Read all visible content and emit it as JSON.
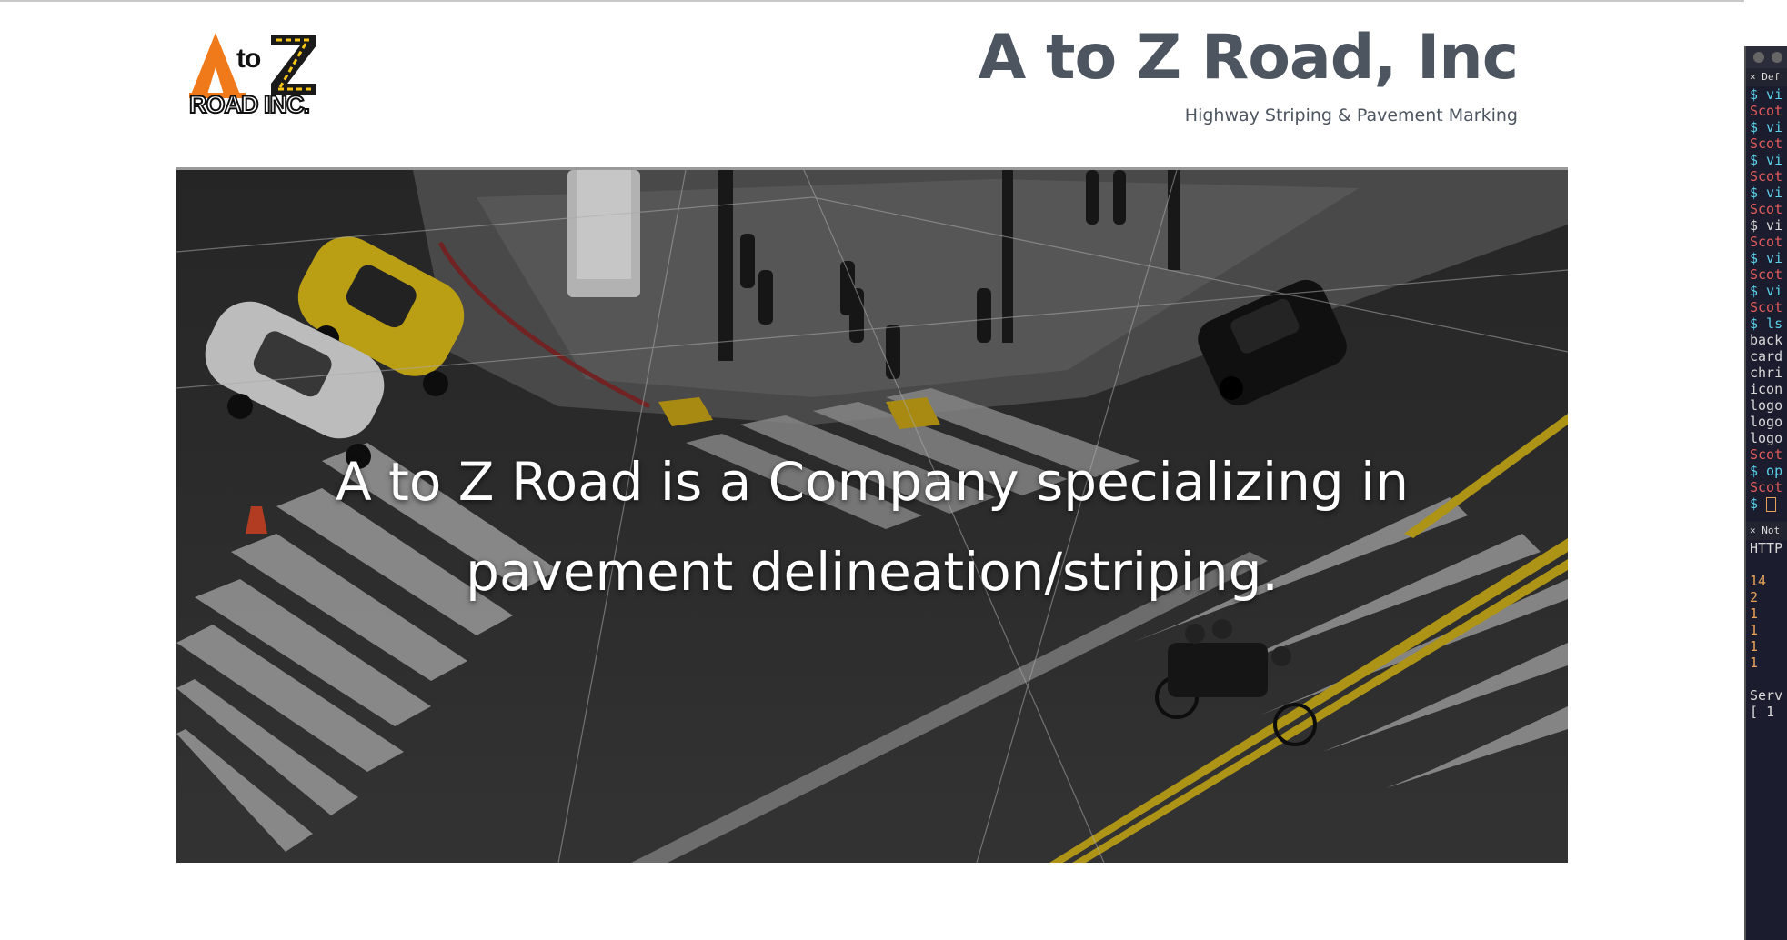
{
  "header": {
    "logo_text_line1_a": "A",
    "logo_text_line1_to": "to",
    "logo_text_line1_z": "Z",
    "logo_text_line2": "ROAD INC.",
    "title": "A to Z Road, Inc",
    "subtitle": "Highway Striping & Pavement Marking"
  },
  "hero": {
    "line1": "A to Z Road is a Company specializing in",
    "line2": "pavement delineation/striping."
  },
  "terminal": {
    "tab1": "Def",
    "tab2": "Not",
    "lines": [
      {
        "cls": "c-prompt",
        "text": "$ vi"
      },
      {
        "cls": "c-red",
        "text": "Scot"
      },
      {
        "cls": "c-prompt",
        "text": "$ vi"
      },
      {
        "cls": "c-red",
        "text": "Scot"
      },
      {
        "cls": "c-prompt",
        "text": "$ vi"
      },
      {
        "cls": "c-red",
        "text": "Scot"
      },
      {
        "cls": "c-prompt",
        "text": "$ vi"
      },
      {
        "cls": "c-red",
        "text": "Scot"
      },
      {
        "cls": "c-white",
        "text": "$ vi"
      },
      {
        "cls": "c-red",
        "text": "Scot"
      },
      {
        "cls": "c-prompt",
        "text": "$ vi"
      },
      {
        "cls": "c-red",
        "text": "Scot"
      },
      {
        "cls": "c-prompt",
        "text": "$ vi"
      },
      {
        "cls": "c-red",
        "text": "Scot"
      },
      {
        "cls": "c-prompt",
        "text": "$ ls"
      },
      {
        "cls": "c-white",
        "text": "back"
      },
      {
        "cls": "c-white",
        "text": "card"
      },
      {
        "cls": "c-white",
        "text": "chri"
      },
      {
        "cls": "c-white",
        "text": "icon"
      },
      {
        "cls": "c-white",
        "text": "logo"
      },
      {
        "cls": "c-white",
        "text": "logo"
      },
      {
        "cls": "c-white",
        "text": "logo"
      },
      {
        "cls": "c-red",
        "text": "Scot"
      },
      {
        "cls": "c-prompt",
        "text": "$ op"
      },
      {
        "cls": "c-red",
        "text": "Scot"
      },
      {
        "cls": "c-prompt",
        "text": "$ "
      }
    ],
    "pane2_lines": [
      {
        "cls": "c-white",
        "text": "HTTP"
      },
      {
        "cls": "c-white",
        "text": ""
      },
      {
        "cls": "c-num",
        "text": "  14"
      },
      {
        "cls": "c-num",
        "text": "   2"
      },
      {
        "cls": "c-num",
        "text": "   1"
      },
      {
        "cls": "c-num",
        "text": "   1"
      },
      {
        "cls": "c-num",
        "text": "   1"
      },
      {
        "cls": "c-num",
        "text": "   1"
      },
      {
        "cls": "c-white",
        "text": ""
      },
      {
        "cls": "c-white",
        "text": "Serv"
      },
      {
        "cls": "c-white",
        "text": "[ 1"
      }
    ]
  },
  "colors": {
    "title_gray": "#4d5560",
    "logo_orange": "#f07a1a",
    "logo_yellow": "#f5c518",
    "taxi_yellow": "#e3c21a",
    "terminal_bg": "#1b1d2e"
  }
}
